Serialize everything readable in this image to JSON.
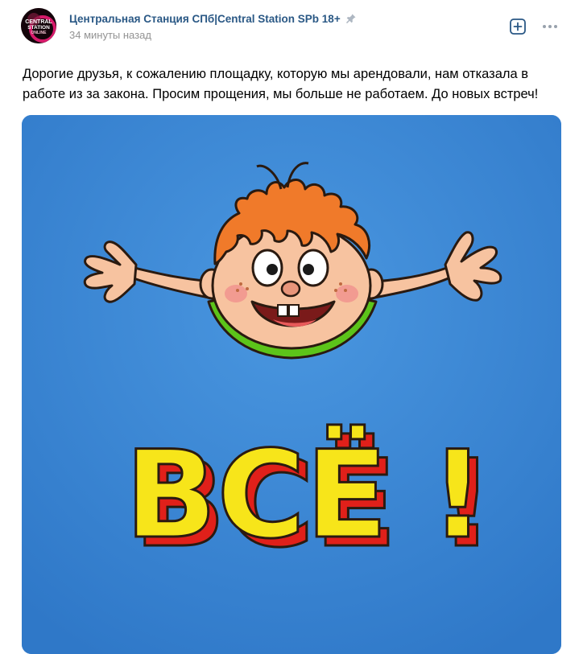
{
  "post": {
    "author": "Центральная Станция СПб|Central Station SPb 18+",
    "time": "34 минуты назад",
    "avatar_text": [
      "CENTRAL",
      "STATION",
      "ONLINE"
    ],
    "text": "Дорогие друзья, к сожалению площадку, которую мы арендовали, нам отказала в работе из за закона. Просим прощения, мы больше не работаем. До новых встреч!",
    "image_caption": "ВСЁ !"
  },
  "colors": {
    "author_link": "#2a5885",
    "time": "#939393",
    "image_bg": "#3a86d6",
    "letters_yellow": "#f7e51a",
    "letters_red": "#e0201a",
    "hair": "#f07a2a",
    "shirt": "#5cc41a"
  },
  "icons": {
    "pin": "pin-icon",
    "add": "add-square-icon",
    "more": "more-horizontal-icon"
  }
}
